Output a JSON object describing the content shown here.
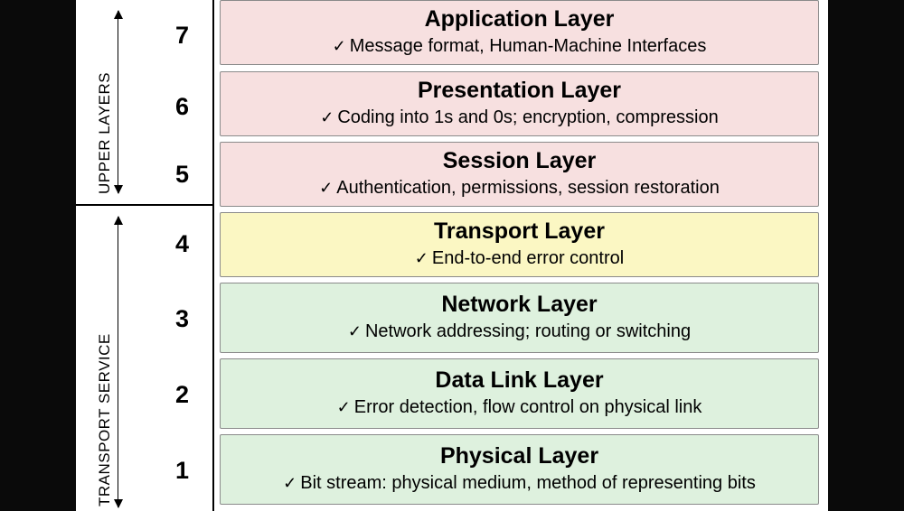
{
  "groups": {
    "upper": "UPPER LAYERS",
    "lower": "TRANSPORT SERVICE"
  },
  "layers": [
    {
      "num": "7",
      "title": "Application Layer",
      "desc": "Message format, Human-Machine Interfaces",
      "color": "pink"
    },
    {
      "num": "6",
      "title": "Presentation Layer",
      "desc": "Coding into 1s and 0s; encryption, compression",
      "color": "pink"
    },
    {
      "num": "5",
      "title": "Session Layer",
      "desc": "Authentication, permissions, session restoration",
      "color": "pink"
    },
    {
      "num": "4",
      "title": "Transport Layer",
      "desc": "End-to-end error control",
      "color": "yellow"
    },
    {
      "num": "3",
      "title": "Network Layer",
      "desc": "Network addressing; routing or switching",
      "color": "green"
    },
    {
      "num": "2",
      "title": "Data Link Layer",
      "desc": "Error detection, flow control on physical link",
      "color": "green"
    },
    {
      "num": "1",
      "title": "Physical Layer",
      "desc": "Bit stream: physical medium, method of representing bits",
      "color": "green"
    }
  ]
}
